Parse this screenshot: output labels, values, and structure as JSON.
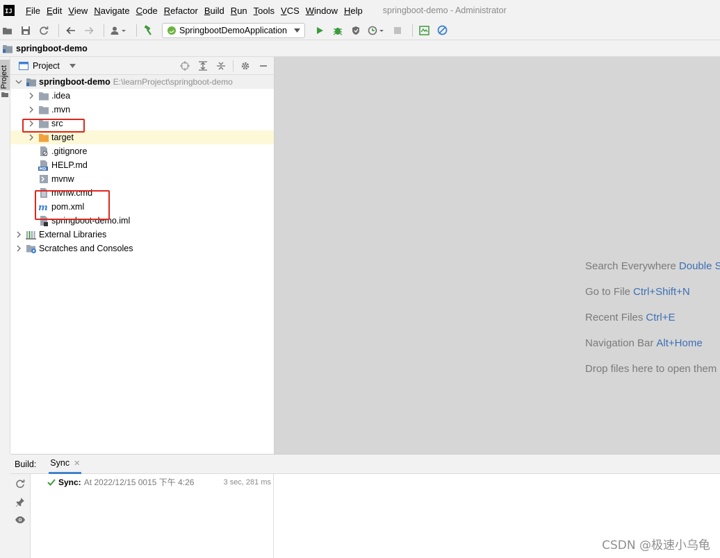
{
  "app": {
    "logo_text": "IJ",
    "window_title": "springboot-demo - Administrator"
  },
  "menu": [
    {
      "mnemonic": "F",
      "rest": "ile"
    },
    {
      "mnemonic": "E",
      "rest": "dit"
    },
    {
      "mnemonic": "V",
      "rest": "iew"
    },
    {
      "mnemonic": "N",
      "rest": "avigate"
    },
    {
      "mnemonic": "C",
      "rest": "ode"
    },
    {
      "mnemonic": "R",
      "rest": "efactor"
    },
    {
      "mnemonic": "B",
      "rest": "uild"
    },
    {
      "mnemonic": "R",
      "rest": "un"
    },
    {
      "mnemonic": "T",
      "rest": "ools"
    },
    {
      "mnemonic": "V",
      "rest": "CS"
    },
    {
      "mnemonic": "W",
      "rest": "indow"
    },
    {
      "mnemonic": "H",
      "rest": "elp"
    }
  ],
  "toolbar": {
    "run_config": "SpringbootDemoApplication"
  },
  "navbar": {
    "project": "springboot-demo"
  },
  "side_strip": {
    "project_tab": "Project"
  },
  "project_panel": {
    "title": "Project",
    "root": {
      "name": "springboot-demo",
      "path": "E:\\learnProject\\springboot-demo"
    },
    "items": [
      {
        "label": ".idea",
        "type": "folder"
      },
      {
        "label": ".mvn",
        "type": "folder"
      },
      {
        "label": "src",
        "type": "folder"
      },
      {
        "label": "target",
        "type": "folder-orange"
      },
      {
        "label": ".gitignore",
        "type": "file"
      },
      {
        "label": "HELP.md",
        "type": "md"
      },
      {
        "label": "mvnw",
        "type": "shell"
      },
      {
        "label": "mvnw.cmd",
        "type": "cmd"
      },
      {
        "label": "pom.xml",
        "type": "maven"
      },
      {
        "label": "springboot-demo.iml",
        "type": "iml"
      }
    ],
    "external_libraries": "External Libraries",
    "scratches": "Scratches and Consoles"
  },
  "editor_hints": [
    {
      "text": "Search Everywhere",
      "key": "Double S"
    },
    {
      "text": "Go to File",
      "key": "Ctrl+Shift+N"
    },
    {
      "text": "Recent Files",
      "key": "Ctrl+E"
    },
    {
      "text": "Navigation Bar",
      "key": "Alt+Home"
    },
    {
      "text": "Drop files here to open them",
      "key": ""
    }
  ],
  "build": {
    "label": "Build:",
    "tab": "Sync",
    "sync_label": "Sync:",
    "sync_time": "At 2022/12/15 0015 下午 4:26",
    "duration": "3 sec, 281 ms"
  },
  "watermark": "CSDN @极速小乌龟",
  "colors": {
    "accent": "#3b6fb5",
    "highlight_box": "#e0261e",
    "run_green": "#3c9a3c"
  }
}
